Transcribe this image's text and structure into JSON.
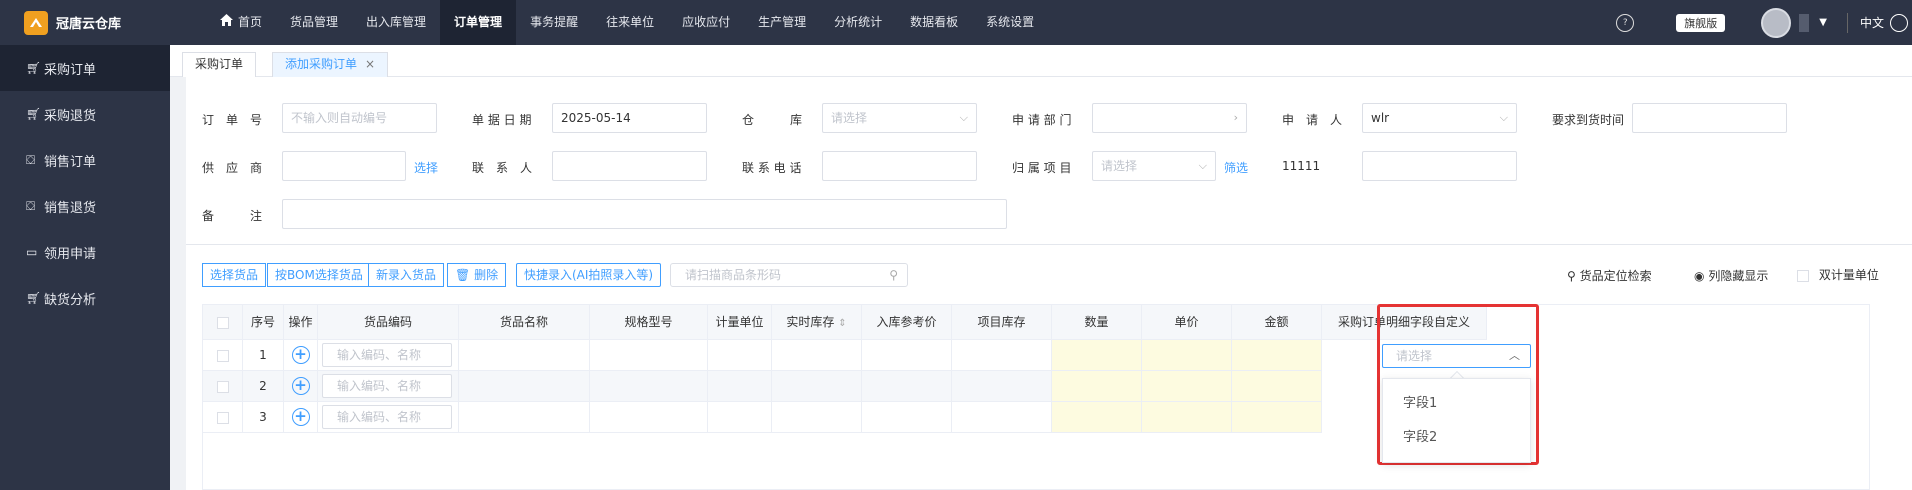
{
  "app": {
    "name": "冠唐云仓库"
  },
  "topnav": [
    {
      "label": "首页",
      "icon": "home-icon"
    },
    {
      "label": "货品管理"
    },
    {
      "label": "出入库管理"
    },
    {
      "label": "订单管理",
      "active": true
    },
    {
      "label": "事务提醒"
    },
    {
      "label": "往来单位"
    },
    {
      "label": "应收应付"
    },
    {
      "label": "生产管理"
    },
    {
      "label": "分析统计"
    },
    {
      "label": "数据看板"
    },
    {
      "label": "系统设置"
    }
  ],
  "topright": {
    "flag": "旗舰版",
    "lang": "中文"
  },
  "sidebar": [
    {
      "label": "采购订单",
      "icon": "cart-icon",
      "active": true
    },
    {
      "label": "采购退货",
      "icon": "cart-icon"
    },
    {
      "label": "销售订单",
      "icon": "bag-icon"
    },
    {
      "label": "销售退货",
      "icon": "bag-icon"
    },
    {
      "label": "领用申请",
      "icon": "briefcase-icon"
    },
    {
      "label": "缺货分析",
      "icon": "cart-icon"
    }
  ],
  "tabs": [
    {
      "label": "采购订单"
    },
    {
      "label": "添加采购订单",
      "active": true,
      "close": "×"
    }
  ],
  "form": {
    "order_no_label": "订　单　号",
    "order_no_ph": "不输入则自动编号",
    "date_label": "单 据 日 期",
    "date_value": "2025-05-14",
    "warehouse_label": "仓　　　库",
    "warehouse_ph": "请选择",
    "dept_label": "申 请 部 门",
    "applicant_label": "申　请　人",
    "applicant_value": "wlr",
    "due_label": "要求到货时间",
    "supplier_label": "供　应　商",
    "supplier_link": "选择",
    "contact_label": "联　系　人",
    "phone_label": "联 系 电 话",
    "project_label": "归 属 项 目",
    "project_ph": "请选择",
    "project_link": "筛选",
    "custom_label": "11111",
    "remark_label": "备　　　注"
  },
  "toolbar": {
    "select_goods": "选择货品",
    "bom_select": "按BOM选择货品",
    "new_goods": "新录入货品",
    "delete": "删除",
    "quick_entry": "快捷录入(AI拍照录入等)",
    "scan_ph": "请扫描商品条形码",
    "locate": "货品定位检索",
    "columns": "列隐藏显示",
    "dual_unit": "双计量单位"
  },
  "table": {
    "columns": [
      "序号",
      "操作",
      "货品编码",
      "货品名称",
      "规格型号",
      "计量单位",
      "实时库存",
      "入库参考价",
      "项目库存",
      "数量",
      "单价",
      "金额",
      "采购订单明细字段自定义"
    ],
    "rows": [
      {
        "no": "1",
        "code_ph": "输入编码、名称"
      },
      {
        "no": "2",
        "code_ph": "输入编码、名称"
      },
      {
        "no": "3",
        "code_ph": "输入编码、名称"
      }
    ]
  },
  "custom_field_dropdown": {
    "placeholder": "请选择",
    "options": [
      "字段1",
      "字段2"
    ]
  },
  "colors": {
    "topbar": "#2d3446",
    "accent": "#409eff",
    "highlight": "#e53333"
  }
}
